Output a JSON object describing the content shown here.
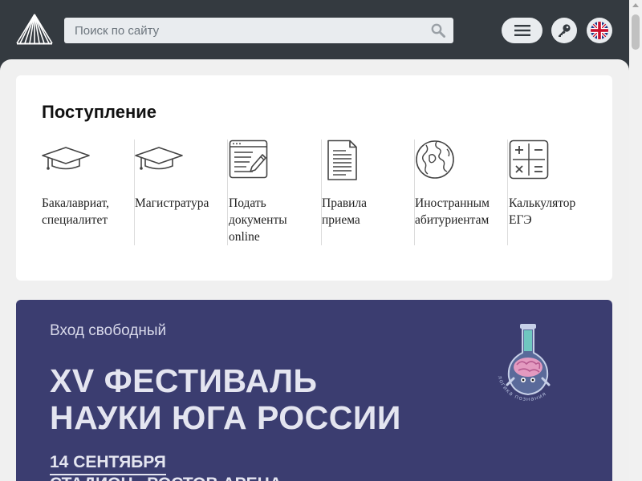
{
  "header": {
    "search_placeholder": "Поиск по сайту",
    "logo_icon": "rays-logo-icon",
    "menu_icon": "hamburger-menu-icon",
    "login_icon": "key-icon",
    "language_icon": "uk-flag-icon"
  },
  "admission": {
    "title": "Поступление",
    "items": [
      {
        "label": "Бакалавриат,\nспециалитет",
        "icon": "mortarboard-icon"
      },
      {
        "label": "Магистратура",
        "icon": "mortarboard-icon"
      },
      {
        "label": "Подать\nдокументы\nonline",
        "icon": "document-edit-icon"
      },
      {
        "label": "Правила\nприема",
        "icon": "document-icon"
      },
      {
        "label": "Иностранным\nабитуриентам",
        "icon": "globe-icon"
      },
      {
        "label": "Калькулятор\nЕГЭ",
        "icon": "calculator-icon"
      }
    ]
  },
  "banner": {
    "subtitle": "Вход свободный",
    "title_line1": "XV ФЕСТИВАЛЬ",
    "title_line2": "НАУКИ ЮГА РОССИИ",
    "date": "14 СЕНТЯБРЯ",
    "place": "СТАДИОН «РОСТОВ АРЕНА»",
    "mascot_caption": "логика познания",
    "colors": {
      "background": "#3b3d70",
      "text": "#e4e5f0"
    }
  },
  "colors": {
    "header_bg": "#343a40",
    "content_bg": "#f0f0f0",
    "card_bg": "#ffffff"
  }
}
